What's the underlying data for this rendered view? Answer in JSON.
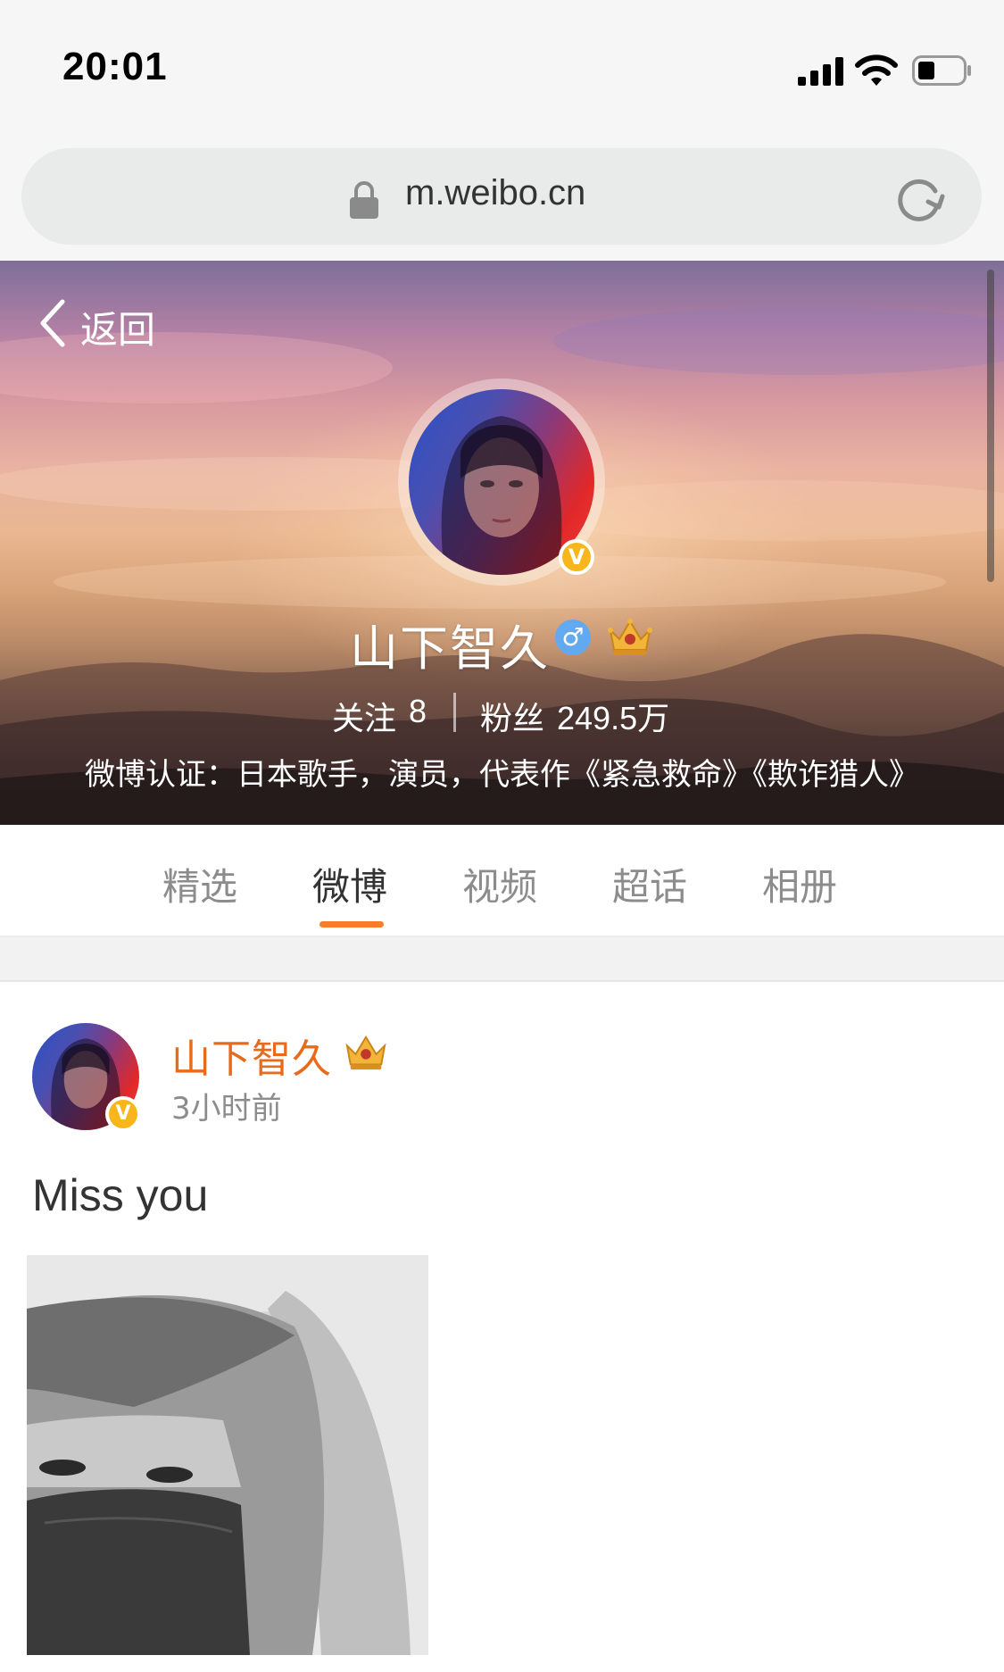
{
  "status_bar": {
    "time": "20:01"
  },
  "browser": {
    "url": "m.weibo.cn"
  },
  "header": {
    "back_label": "返回"
  },
  "profile": {
    "name": "山下智久",
    "verified_badge": "V",
    "gender_symbol": "♂",
    "following_label": "关注",
    "following_count": "8",
    "fans_label": "粉丝",
    "fans_count": "249.5万",
    "verification": "微博认证：日本歌手，演员，代表作《紧急救命》《欺诈猎人》"
  },
  "tabs": [
    {
      "label": "精选"
    },
    {
      "label": "微博"
    },
    {
      "label": "视频"
    },
    {
      "label": "超话"
    },
    {
      "label": "相册"
    }
  ],
  "active_tab": "微博",
  "post": {
    "author": "山下智久",
    "verified_badge": "V",
    "time": "3小时前",
    "text": "Miss you"
  },
  "colors": {
    "accent_orange": "#fa7d28",
    "author_orange": "#e86b1c",
    "verified_gold": "#f7b71c",
    "gender_blue": "#63a9f0"
  }
}
